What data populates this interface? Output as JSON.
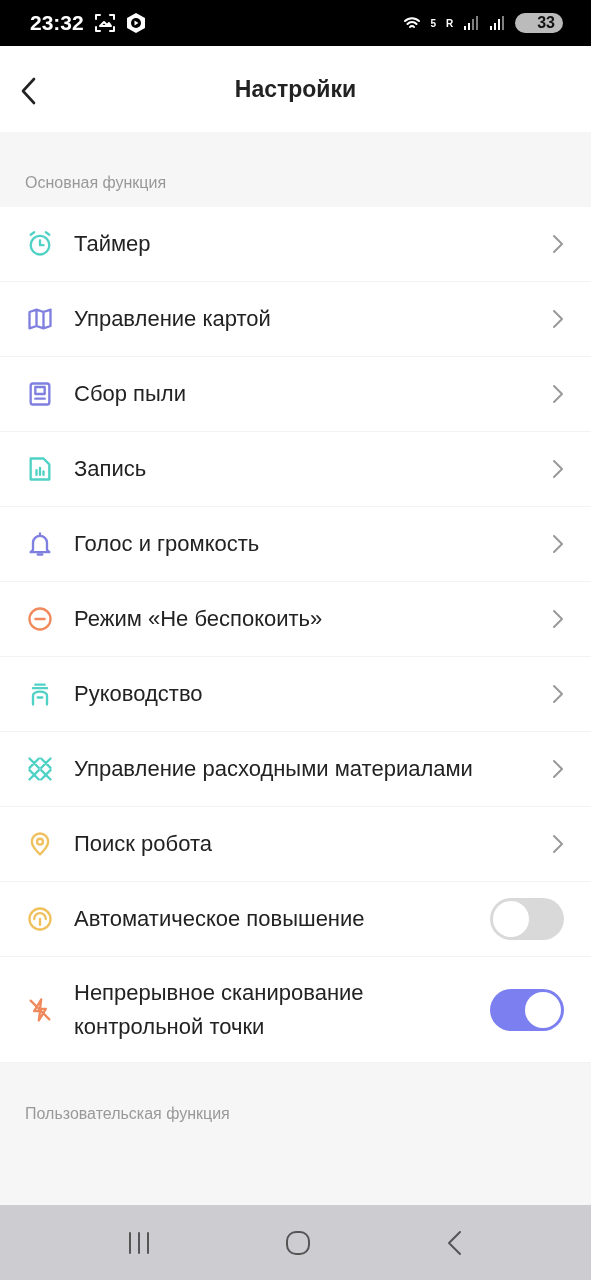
{
  "status_bar": {
    "time": "23:32",
    "wifi_label": "5",
    "roaming_label": "R",
    "battery": "33"
  },
  "header": {
    "title": "Настройки"
  },
  "sections": [
    {
      "title": "Основная функция",
      "items": [
        {
          "kind": "link",
          "label": "Таймер"
        },
        {
          "kind": "link",
          "label": "Управление картой"
        },
        {
          "kind": "link",
          "label": "Сбор пыли"
        },
        {
          "kind": "link",
          "label": "Запись"
        },
        {
          "kind": "link",
          "label": "Голос и громкость"
        },
        {
          "kind": "link",
          "label": "Режим «Не беспокоить»"
        },
        {
          "kind": "link",
          "label": "Руководство"
        },
        {
          "kind": "link",
          "label": "Управление расходными материалами"
        },
        {
          "kind": "link",
          "label": "Поиск робота"
        },
        {
          "kind": "toggle",
          "label": "Автоматическое повышение",
          "on": false
        },
        {
          "kind": "toggle",
          "label": "Непрерывное сканирование контрольной точки",
          "on": true
        }
      ]
    },
    {
      "title": "Пользовательская функция"
    }
  ]
}
